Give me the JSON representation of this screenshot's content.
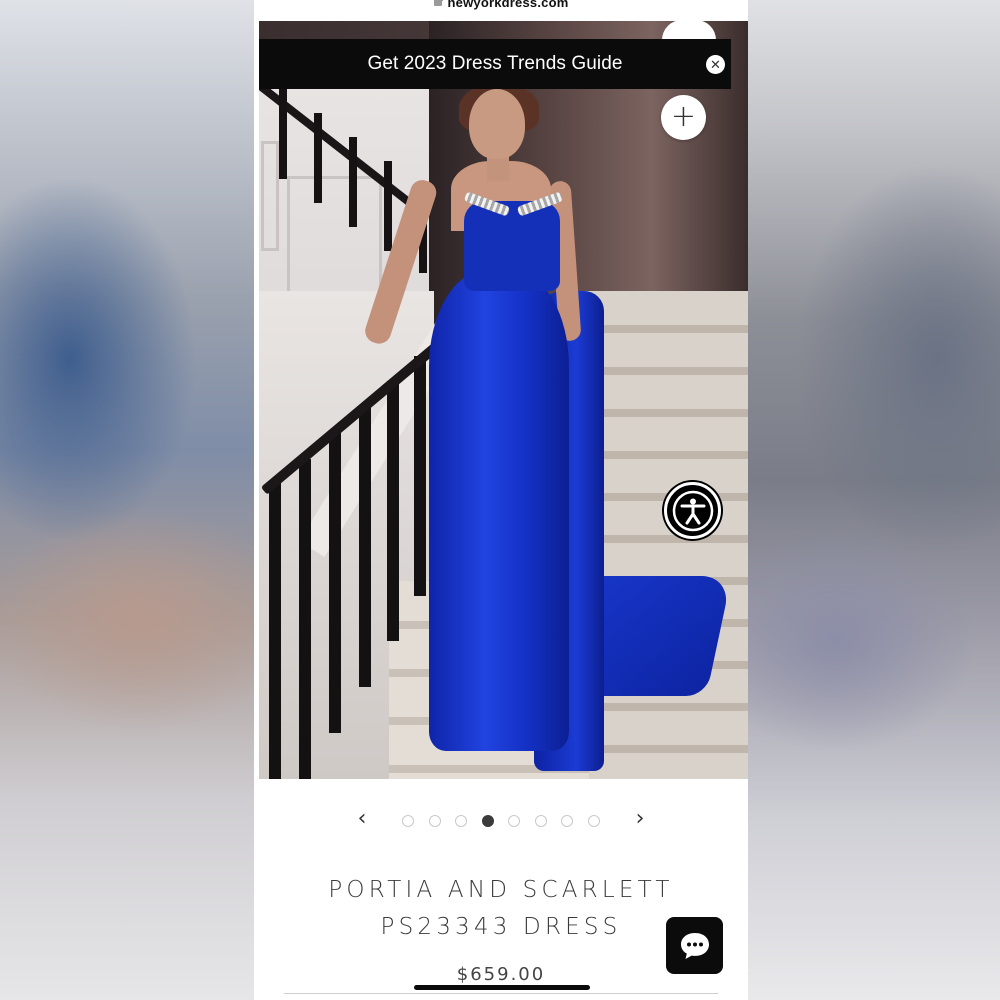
{
  "browser": {
    "url": "newyorkdress.com",
    "lock_icon": "lock-icon"
  },
  "promo_banner": {
    "text": "Get 2023 Dress Trends Guide",
    "close_icon": "close-icon"
  },
  "photo": {
    "add_icon": "plus-icon",
    "accessibility_icon": "accessibility-icon"
  },
  "carousel": {
    "prev_label": "‹",
    "next_label": "›",
    "total_slides": 8,
    "active_slide": 4
  },
  "product": {
    "title_line1": "PORTIA AND SCARLETT",
    "title_line2": "PS23343 DRESS",
    "price": "$659.00"
  },
  "chat": {
    "icon": "chat-bubble-icon"
  },
  "colors": {
    "dress_blue": "#1a38d0",
    "banner_bg": "#0b0b0b"
  }
}
